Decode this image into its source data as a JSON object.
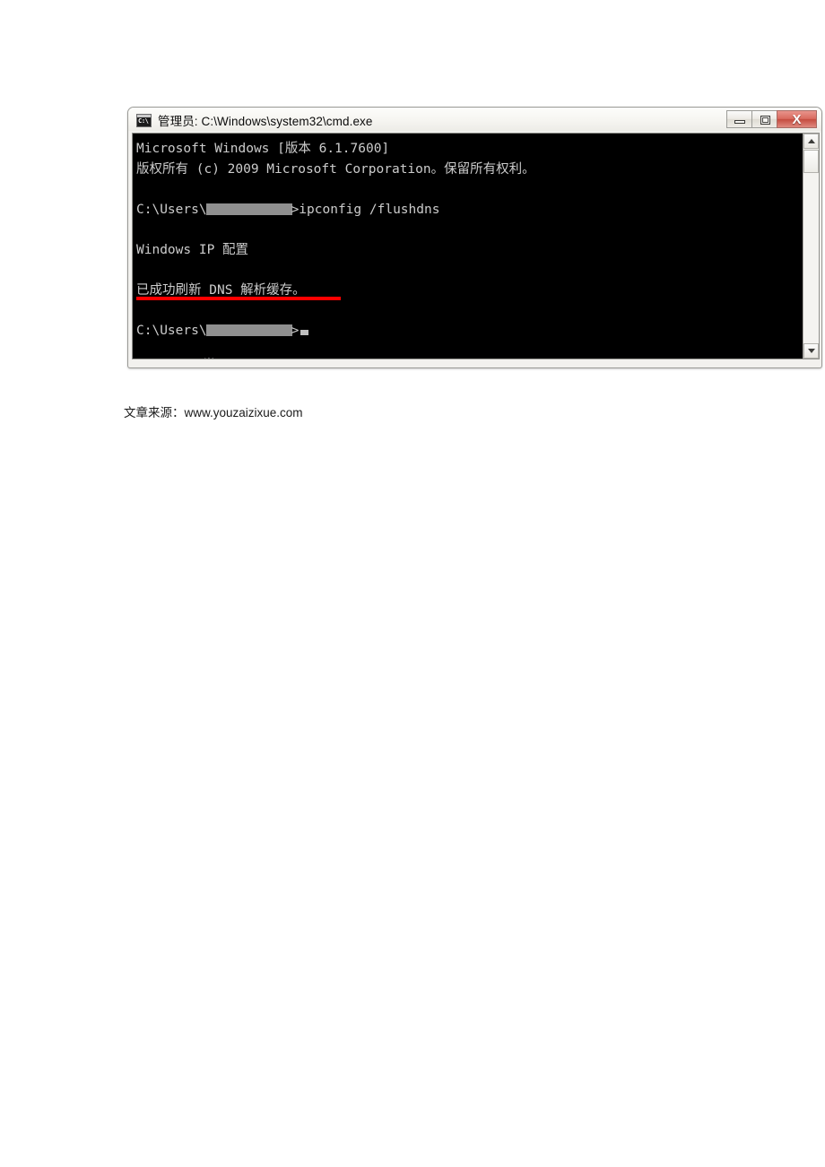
{
  "window": {
    "title": "管理员: C:\\Windows\\system32\\cmd.exe",
    "icon": "cmd-console-icon",
    "icon_text": "C:\\",
    "controls": {
      "minimize_label": "—",
      "maximize_label": "□",
      "close_label": "X"
    },
    "accent_close_color": "#c44b3e",
    "titlebar_color": "#f6f5f1"
  },
  "console": {
    "background_color": "#000000",
    "foreground_color": "#cccccc",
    "lines": [
      {
        "id": "banner-version",
        "text": "Microsoft Windows [版本 6.1.7600]"
      },
      {
        "id": "banner-copyright",
        "text": "版权所有 (c) 2009 Microsoft Corporation。保留所有权利。"
      },
      {
        "id": "blank-1",
        "text": ""
      },
      {
        "id": "prompt-command",
        "prefix": "C:\\Users\\",
        "redacted": true,
        "suffix": ">ipconfig /flushdns"
      },
      {
        "id": "blank-2",
        "text": ""
      },
      {
        "id": "output-heading",
        "text": "Windows IP 配置"
      },
      {
        "id": "blank-3",
        "text": ""
      },
      {
        "id": "output-success",
        "text": "已成功刷新 DNS 解析缓存。",
        "annotated": true
      },
      {
        "id": "blank-4",
        "text": ""
      },
      {
        "id": "prompt-idle",
        "prefix": "C:\\Users\\",
        "redacted": true,
        "suffix": ">",
        "cursor": true
      },
      {
        "id": "blank-5",
        "text": ""
      },
      {
        "id": "artifact-line",
        "text": "半:"
      }
    ],
    "annotation": {
      "type": "red-underline",
      "color": "#ff0000",
      "target_line": "output-success"
    }
  },
  "scrollbar": {
    "up_arrow": "scroll-up-arrow",
    "down_arrow": "scroll-down-arrow",
    "thumb_position_percent": 4
  },
  "footer": {
    "label": "文章来源：",
    "url": "www.youzaizixue.com"
  }
}
